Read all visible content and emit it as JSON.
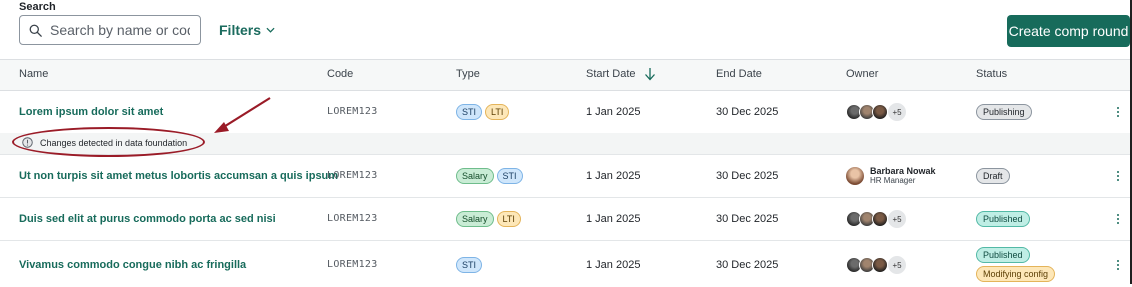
{
  "search": {
    "label": "Search",
    "placeholder": "Search by name or code"
  },
  "filters": {
    "label": "Filters"
  },
  "create_button": {
    "label": "Create comp round"
  },
  "columns": [
    "Name",
    "Code",
    "Type",
    "Start Date",
    "End Date",
    "Owner",
    "Status"
  ],
  "rows": [
    {
      "name": "Lorem ipsum dolor sit amet",
      "code": "LOREM123",
      "types": [
        "STI",
        "LTI"
      ],
      "start": "1 Jan 2025",
      "end": "30 Dec 2025",
      "owner_more": "+5",
      "statuses": [
        "Publishing"
      ],
      "notice": "Changes detected in data foundation"
    },
    {
      "name": "Ut non turpis sit amet metus lobortis accumsan a quis ipsum",
      "code": "LOREM123",
      "types": [
        "Salary",
        "STI"
      ],
      "start": "1 Jan 2025",
      "end": "30 Dec 2025",
      "owner_name": "Barbara Nowak",
      "owner_role": "HR Manager",
      "statuses": [
        "Draft"
      ]
    },
    {
      "name": "Duis sed elit at purus commodo porta ac sed nisi",
      "code": "LOREM123",
      "types": [
        "Salary",
        "LTI"
      ],
      "start": "1 Jan 2025",
      "end": "30 Dec 2025",
      "owner_more": "+5",
      "statuses": [
        "Published"
      ]
    },
    {
      "name": "Vivamus commodo congue nibh ac fringilla",
      "code": "LOREM123",
      "types": [
        "STI"
      ],
      "start": "1 Jan 2025",
      "end": "30 Dec 2025",
      "owner_more": "+5",
      "statuses": [
        "Published",
        "Modifying config"
      ]
    }
  ],
  "colors": {
    "accent": "#176b5b",
    "annotation": "#9a1b27",
    "sti": "#cfe6fb",
    "lti": "#fde7b8",
    "salary": "#c9ecd5",
    "published": "#bfeee5"
  }
}
